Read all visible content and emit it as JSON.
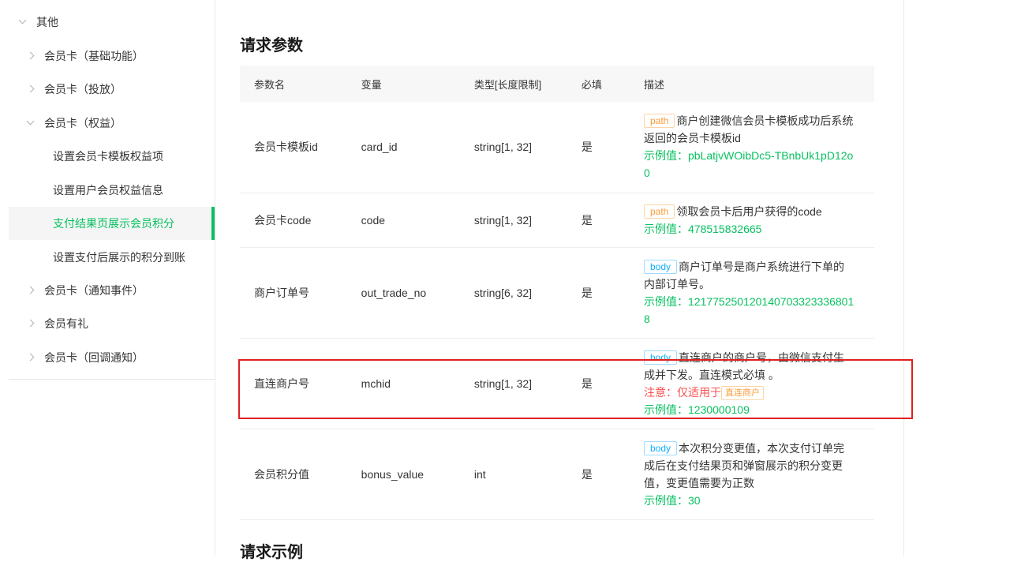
{
  "sidebar": {
    "items": [
      {
        "label": "其他",
        "type": "group-open"
      },
      {
        "label": "会员卡（基础功能）",
        "type": "collapsed"
      },
      {
        "label": "会员卡（投放）",
        "type": "collapsed"
      },
      {
        "label": "会员卡（权益）",
        "type": "open"
      },
      {
        "label": "设置会员卡模板权益项",
        "type": "child"
      },
      {
        "label": "设置用户会员权益信息",
        "type": "child"
      },
      {
        "label": "支付结果页展示会员积分",
        "type": "active"
      },
      {
        "label": "设置支付后展示的积分到账",
        "type": "child"
      },
      {
        "label": "会员卡（通知事件）",
        "type": "collapsed"
      },
      {
        "label": "会员有礼",
        "type": "collapsed"
      },
      {
        "label": "会员卡（回调通知）",
        "type": "collapsed"
      }
    ]
  },
  "main": {
    "title": "请求参数",
    "next_title": "请求示例",
    "headers": [
      "参数名",
      "变量",
      "类型[长度限制]",
      "必填",
      "描述"
    ],
    "rows": [
      {
        "name": "会员卡模板id",
        "var": "card_id",
        "type": "string[1, 32]",
        "required": "是",
        "tag": "path",
        "desc": "商户创建微信会员卡模板成功后系统返回的会员卡模板id",
        "example": "示例值：pbLatjvWOibDc5-TBnbUk1pD12o0"
      },
      {
        "name": "会员卡code",
        "var": "code",
        "type": "string[1, 32]",
        "required": "是",
        "tag": "path",
        "desc": "领取会员卡后用户获得的code",
        "example": "示例值：478515832665"
      },
      {
        "name": "商户订单号",
        "var": "out_trade_no",
        "type": "string[6, 32]",
        "required": "是",
        "tag": "body",
        "desc": "商户订单号是商户系统进行下单的内部订单号。",
        "example": "示例值：1217752501201407033233368018"
      },
      {
        "name": "直连商户号",
        "var": "mchid",
        "type": "string[1, 32]",
        "required": "是",
        "tag": "body",
        "desc": "直连商户的商户号，由微信支付生成并下发。直连模式必填 。",
        "warn": "注意：仅适用于",
        "warn_tag": "直连商户",
        "example": "示例值：1230000109"
      },
      {
        "name": "会员积分值",
        "var": "bonus_value",
        "type": "int",
        "required": "是",
        "tag": "body",
        "desc": "本次积分变更值，本次支付订单完成后在支付结果页和弹窗展示的积分变更值，变更值需要为正数",
        "example": "示例值：30"
      }
    ]
  },
  "colors": {
    "accent": "#07c160",
    "highlight": "#e02020",
    "path_tag": "#fa9d3b",
    "body_tag": "#10aeff"
  }
}
